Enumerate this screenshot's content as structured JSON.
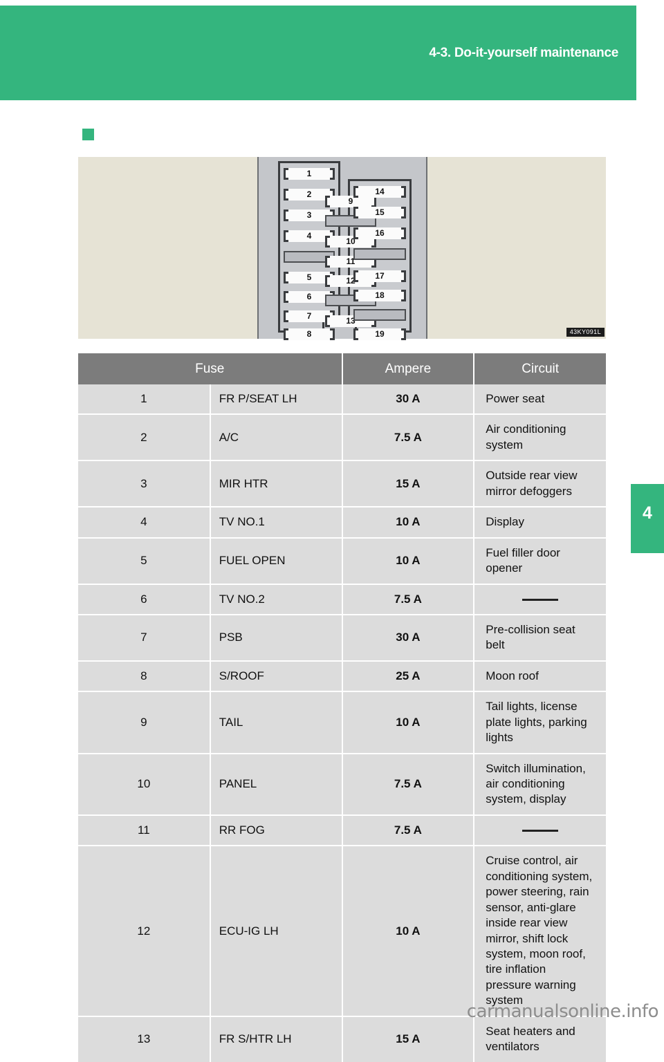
{
  "page": {
    "header_title": "4-3. Do-it-yourself maintenance",
    "chapter_number": "4",
    "watermark": "carmanualsonline.info"
  },
  "figure": {
    "code_label": "43KY091L",
    "left_column_slots": [
      "1",
      "2",
      "3",
      "4",
      "5",
      "6",
      "7",
      "8"
    ],
    "middle_column_slots": [
      "9",
      "10",
      "11",
      "12",
      "13"
    ],
    "right_column_slots": [
      "14",
      "15",
      "16",
      "17",
      "18",
      "19"
    ]
  },
  "table": {
    "headers": {
      "fuse": "Fuse",
      "ampere": "Ampere",
      "circuit": "Circuit"
    },
    "rows": [
      {
        "no": "1",
        "name": "FR P/SEAT LH",
        "ampere": "30 A",
        "circuit": "Power seat"
      },
      {
        "no": "2",
        "name": "A/C",
        "ampere": "7.5 A",
        "circuit": "Air conditioning system"
      },
      {
        "no": "3",
        "name": "MIR HTR",
        "ampere": "15 A",
        "circuit": "Outside rear view mirror defoggers"
      },
      {
        "no": "4",
        "name": "TV NO.1",
        "ampere": "10 A",
        "circuit": "Display"
      },
      {
        "no": "5",
        "name": "FUEL OPEN",
        "ampere": "10 A",
        "circuit": "Fuel filler door opener"
      },
      {
        "no": "6",
        "name": "TV NO.2",
        "ampere": "7.5 A",
        "circuit": ""
      },
      {
        "no": "7",
        "name": "PSB",
        "ampere": "30 A",
        "circuit": "Pre-collision seat belt"
      },
      {
        "no": "8",
        "name": "S/ROOF",
        "ampere": "25 A",
        "circuit": "Moon roof"
      },
      {
        "no": "9",
        "name": "TAIL",
        "ampere": "10 A",
        "circuit": "Tail lights, license plate lights, parking lights"
      },
      {
        "no": "10",
        "name": "PANEL",
        "ampere": "7.5 A",
        "circuit": "Switch illumination, air conditioning system, display"
      },
      {
        "no": "11",
        "name": "RR FOG",
        "ampere": "7.5 A",
        "circuit": ""
      },
      {
        "no": "12",
        "name": "ECU-IG LH",
        "ampere": "10 A",
        "circuit": "Cruise control, air conditioning system, power steering, rain sensor, anti-glare inside rear view mirror, shift lock system, moon roof, tire inflation pressure warning system"
      },
      {
        "no": "13",
        "name": "FR S/HTR LH",
        "ampere": "15 A",
        "circuit": "Seat heaters and ventilators"
      }
    ]
  },
  "colors": {
    "brand_green": "#34B57E",
    "figure_beige": "#E6E3D5",
    "table_header_gray": "#7C7C7C",
    "table_cell_gray": "#DCDCDC"
  }
}
